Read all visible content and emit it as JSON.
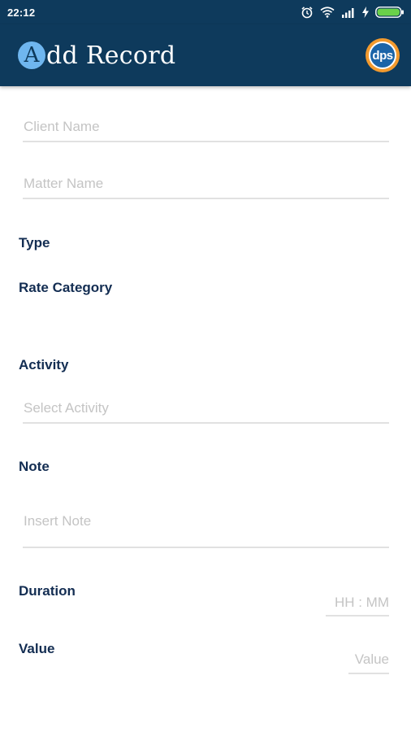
{
  "status_bar": {
    "time": "22:12",
    "icons": [
      "alarm-icon",
      "wifi-icon",
      "signal-icon",
      "charging-icon",
      "battery-icon"
    ],
    "battery_color": "#6ad14a"
  },
  "app_bar": {
    "badge_letter": "A",
    "title": "dd Record",
    "logo_text": "dps",
    "background": "#0e3a5c"
  },
  "form": {
    "client_name": {
      "placeholder": "Client Name"
    },
    "matter_name": {
      "placeholder": "Matter Name"
    },
    "type_label": "Type",
    "rate_category_label": "Rate Category",
    "activity_label": "Activity",
    "activity": {
      "placeholder": "Select Activity"
    },
    "note_label": "Note",
    "note": {
      "placeholder": "Insert Note"
    },
    "duration_label": "Duration",
    "duration": {
      "placeholder": "HH : MM"
    },
    "value_label": "Value",
    "value": {
      "placeholder": "Value"
    }
  }
}
